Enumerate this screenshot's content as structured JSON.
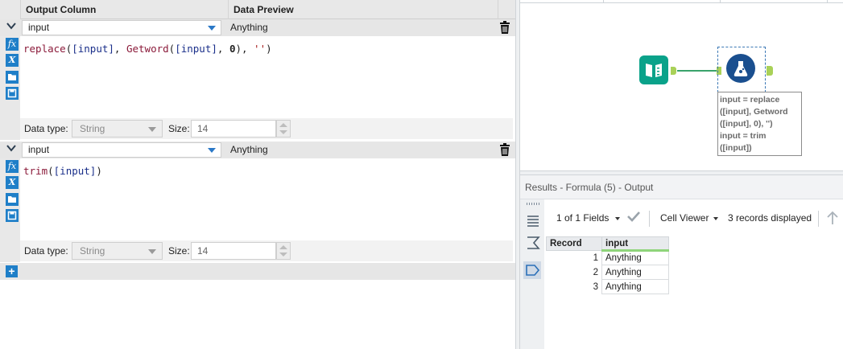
{
  "formula": {
    "headers": {
      "output_column": "Output Column",
      "data_preview": "Data Preview"
    },
    "expressions": [
      {
        "column": "input",
        "preview": "Anything",
        "code": {
          "fn1": "replace",
          "fld1": "[input]",
          "fn2": "Getword",
          "fld2": "[input]",
          "num": "0",
          "str": "''"
        },
        "data_type_label": "Data type:",
        "data_type": "String",
        "size_label": "Size:",
        "size": "14"
      },
      {
        "column": "input",
        "preview": "Anything",
        "code": {
          "fn1": "trim",
          "fld1": "[input]"
        },
        "data_type_label": "Data type:",
        "data_type": "String",
        "size_label": "Size:",
        "size": "14"
      }
    ],
    "add_symbol": "+"
  },
  "canvas": {
    "annotation": "input = replace\n([input], Getword\n([input], 0), '')\ninput = trim\n([input])"
  },
  "results": {
    "title": "Results - Formula (5) - Output",
    "fields_label": "1 of 1 Fields",
    "viewer_label": "Cell Viewer",
    "records_label": "3 records displayed",
    "columns": [
      "Record",
      "input"
    ],
    "rows": [
      {
        "record": "1",
        "input": "Anything"
      },
      {
        "record": "2",
        "input": "Anything"
      },
      {
        "record": "3",
        "input": "Anything"
      }
    ]
  },
  "colors": {
    "accent": "#1f7fc8",
    "tool_input": "#0aa28a",
    "tool_formula": "#1a4f8f",
    "anchor": "#a9d158"
  }
}
